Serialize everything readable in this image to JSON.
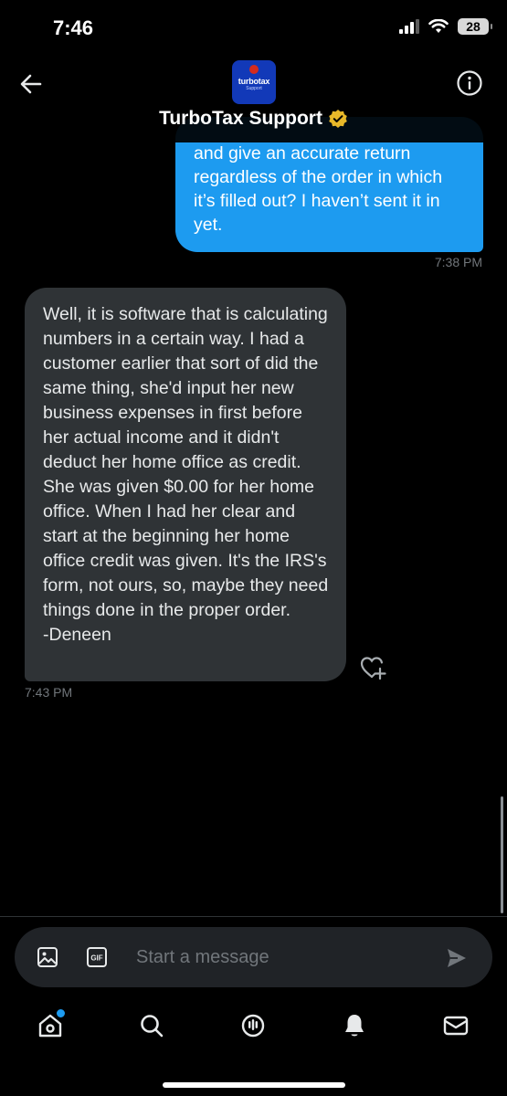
{
  "status": {
    "time": "7:46",
    "battery": "28"
  },
  "header": {
    "title": "TurboTax Support",
    "avatar_brand": "turbotax",
    "avatar_sub": "Support",
    "verified_color": "#e8b829"
  },
  "messages": [
    {
      "direction": "outgoing",
      "text": "and give an accurate return regardless of the order in which it’s filled out? I haven’t sent it in yet.",
      "time": "7:38 PM",
      "color": "#1d9bf0"
    },
    {
      "direction": "incoming",
      "text": "Well, it is software that is calculating numbers in a certain way. I had a customer earlier that sort of did the same thing, she'd input her new business expenses in first before her actual income and it didn't deduct her home office as credit. She was given $0.00 for her home office. When I had her clear and start at the beginning her home office credit was given. It's the IRS's form, not ours, so, maybe they need things done in the proper order.\n-Deneen",
      "time": "7:43 PM",
      "color": "#2f3336"
    }
  ],
  "composer": {
    "placeholder": "Start a message",
    "icons": [
      "image-icon",
      "gif-icon",
      "send-icon"
    ]
  },
  "tabbar": {
    "items": [
      "home-icon",
      "search-icon",
      "spaces-icon",
      "notifications-icon",
      "messages-icon"
    ],
    "home_has_dot": true
  }
}
